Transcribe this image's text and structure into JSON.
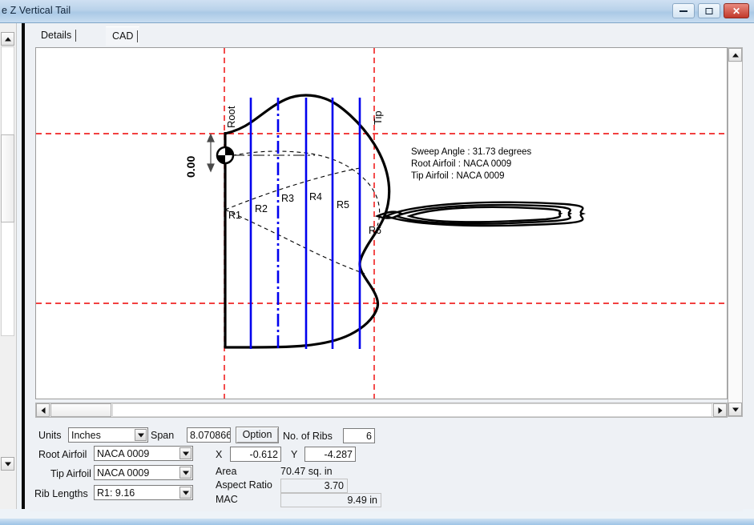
{
  "window": {
    "title": "e Z Vertical Tail",
    "buttons": {
      "minimize": "minimize",
      "maximize": "maximize",
      "close": "✕"
    }
  },
  "tabs": [
    {
      "label": "Details",
      "selected": false
    },
    {
      "label": "CAD",
      "selected": true
    }
  ],
  "drawing": {
    "labels": {
      "root": "Root",
      "tip": "Tip",
      "dimension": "0.00"
    },
    "ribs": [
      "R1",
      "R2",
      "R3",
      "R4",
      "R5",
      "R6"
    ],
    "annotation": [
      "Sweep Angle : 31.73 degrees",
      "Root Airfoil : NACA 0009",
      "Tip Airfoil    : NACA 0009"
    ],
    "colors": {
      "rib_line": "#0000ee",
      "reference_line": "#ee0000",
      "outline": "#000000"
    }
  },
  "panel": {
    "units_label": "Units",
    "units_value": "Inches",
    "span_label": "Span",
    "span_value": "8.070866",
    "option_button": "Option",
    "ribs_label": "No. of Ribs",
    "ribs_value": "6",
    "root_airfoil_label": "Root Airfoil",
    "root_airfoil_value": "NACA 0009",
    "tip_airfoil_label": "Tip Airfoil",
    "tip_airfoil_value": "NACA 0009",
    "rib_lengths_label": "Rib Lengths",
    "rib_lengths_value": "R1: 9.16",
    "x_label": "X",
    "x_value": "-0.612",
    "y_label": "Y",
    "y_value": "-4.287",
    "area_label": "Area",
    "area_value": "70.47 sq. in",
    "aspect_label": "Aspect Ratio",
    "aspect_value": "3.70",
    "mac_label": "MAC",
    "mac_value": "9.49 in"
  }
}
